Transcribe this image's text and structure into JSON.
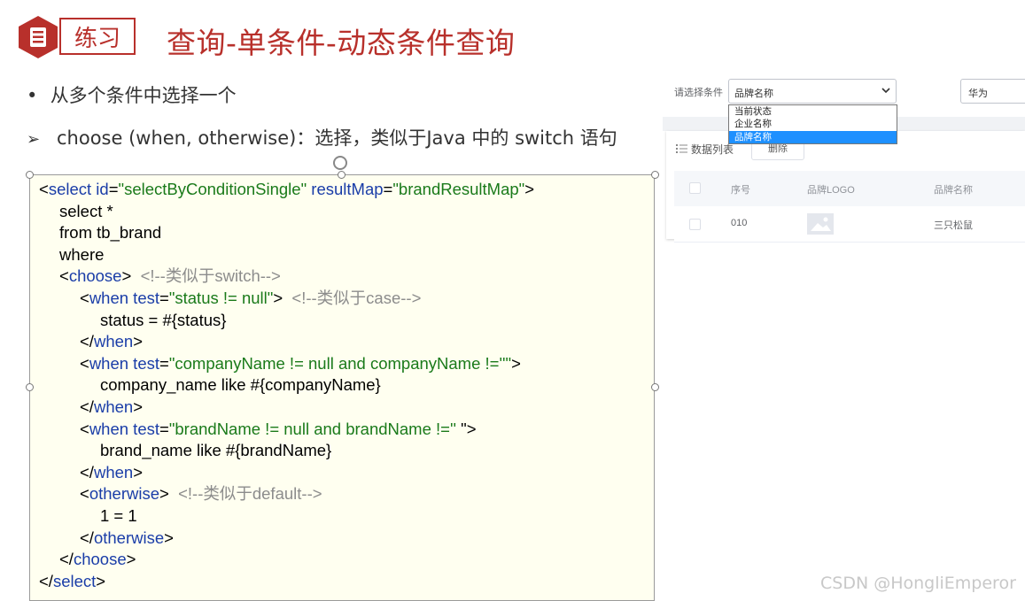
{
  "header": {
    "badge_label": "练习",
    "title": "查询-单条件-动态条件查询",
    "brand_color": "#b8302b"
  },
  "bullets": [
    {
      "marker": "•",
      "text": "从多个条件中选择一个"
    },
    {
      "marker": "➢",
      "text": "choose (when, otherwise)：选择，类似于Java 中的 switch 语句"
    }
  ],
  "code_lines": [
    {
      "indent": 0,
      "parts": [
        [
          "p",
          "<"
        ],
        [
          "k",
          "select id"
        ],
        [
          "p",
          "="
        ],
        [
          "s",
          "\"selectByConditionSingle\""
        ],
        [
          "p",
          " "
        ],
        [
          "k",
          "resultMap"
        ],
        [
          "p",
          "="
        ],
        [
          "s",
          "\"brandResultMap\""
        ],
        [
          "p",
          ">"
        ]
      ]
    },
    {
      "indent": 1,
      "parts": [
        [
          "p",
          "select *"
        ]
      ]
    },
    {
      "indent": 1,
      "parts": [
        [
          "p",
          "from tb_brand"
        ]
      ]
    },
    {
      "indent": 1,
      "parts": [
        [
          "p",
          "where"
        ]
      ]
    },
    {
      "indent": 1,
      "parts": [
        [
          "p",
          "<"
        ],
        [
          "k",
          "choose"
        ],
        [
          "p",
          ">  "
        ],
        [
          "c",
          "<!--类似于switch-->"
        ]
      ]
    },
    {
      "indent": 2,
      "parts": [
        [
          "p",
          "<"
        ],
        [
          "k",
          "when test"
        ],
        [
          "p",
          "="
        ],
        [
          "s",
          "\"status != null\""
        ],
        [
          "p",
          ">  "
        ],
        [
          "c",
          "<!--类似于case-->"
        ]
      ]
    },
    {
      "indent": 3,
      "parts": [
        [
          "p",
          "status = #{status}"
        ]
      ]
    },
    {
      "indent": 2,
      "parts": [
        [
          "p",
          "</"
        ],
        [
          "k",
          "when"
        ],
        [
          "p",
          ">"
        ]
      ]
    },
    {
      "indent": 2,
      "parts": [
        [
          "p",
          "<"
        ],
        [
          "k",
          "when test"
        ],
        [
          "p",
          "="
        ],
        [
          "s",
          "\"companyName != null and companyName !=''\""
        ],
        [
          "p",
          ">"
        ]
      ]
    },
    {
      "indent": 3,
      "parts": [
        [
          "p",
          "company_name like #{companyName}"
        ]
      ]
    },
    {
      "indent": 2,
      "parts": [
        [
          "p",
          "</"
        ],
        [
          "k",
          "when"
        ],
        [
          "p",
          ">"
        ]
      ]
    },
    {
      "indent": 2,
      "parts": [
        [
          "p",
          "<"
        ],
        [
          "k",
          "when test"
        ],
        [
          "p",
          "="
        ],
        [
          "s",
          "\"brandName != null and brandName !=''"
        ],
        [
          "p",
          " \">"
        ]
      ]
    },
    {
      "indent": 3,
      "parts": [
        [
          "p",
          "brand_name like #{brandName}"
        ]
      ]
    },
    {
      "indent": 2,
      "parts": [
        [
          "p",
          "</"
        ],
        [
          "k",
          "when"
        ],
        [
          "p",
          ">"
        ]
      ]
    },
    {
      "indent": 2,
      "parts": [
        [
          "p",
          "<"
        ],
        [
          "k",
          "otherwise"
        ],
        [
          "p",
          ">  "
        ],
        [
          "c",
          "<!--类似于default-->"
        ]
      ]
    },
    {
      "indent": 3,
      "parts": [
        [
          "p",
          "1 = 1"
        ]
      ]
    },
    {
      "indent": 2,
      "parts": [
        [
          "p",
          "</"
        ],
        [
          "k",
          "otherwise"
        ],
        [
          "p",
          ">"
        ]
      ]
    },
    {
      "indent": 1,
      "parts": [
        [
          "p",
          "</"
        ],
        [
          "k",
          "choose"
        ],
        [
          "p",
          ">"
        ]
      ]
    },
    {
      "indent": 0,
      "parts": [
        [
          "p",
          "</"
        ],
        [
          "k",
          "select"
        ],
        [
          "p",
          ">"
        ]
      ]
    }
  ],
  "code_colors": {
    "keyword": "#1a3da8",
    "string": "#1a7a1a",
    "comment": "#8c8c8c"
  },
  "filter": {
    "label": "请选择条件",
    "select_value": "品牌名称",
    "options": [
      "当前状态",
      "企业名称",
      "品牌名称"
    ],
    "selected_index": 2,
    "input_value": "华为"
  },
  "list": {
    "title": "数据列表",
    "delete_label": "删除",
    "columns": [
      "序号",
      "品牌LOGO",
      "品牌名称"
    ],
    "rows": [
      {
        "index": "010",
        "brand": "三只松鼠"
      }
    ]
  },
  "watermark": "CSDN @HongliEmperor"
}
